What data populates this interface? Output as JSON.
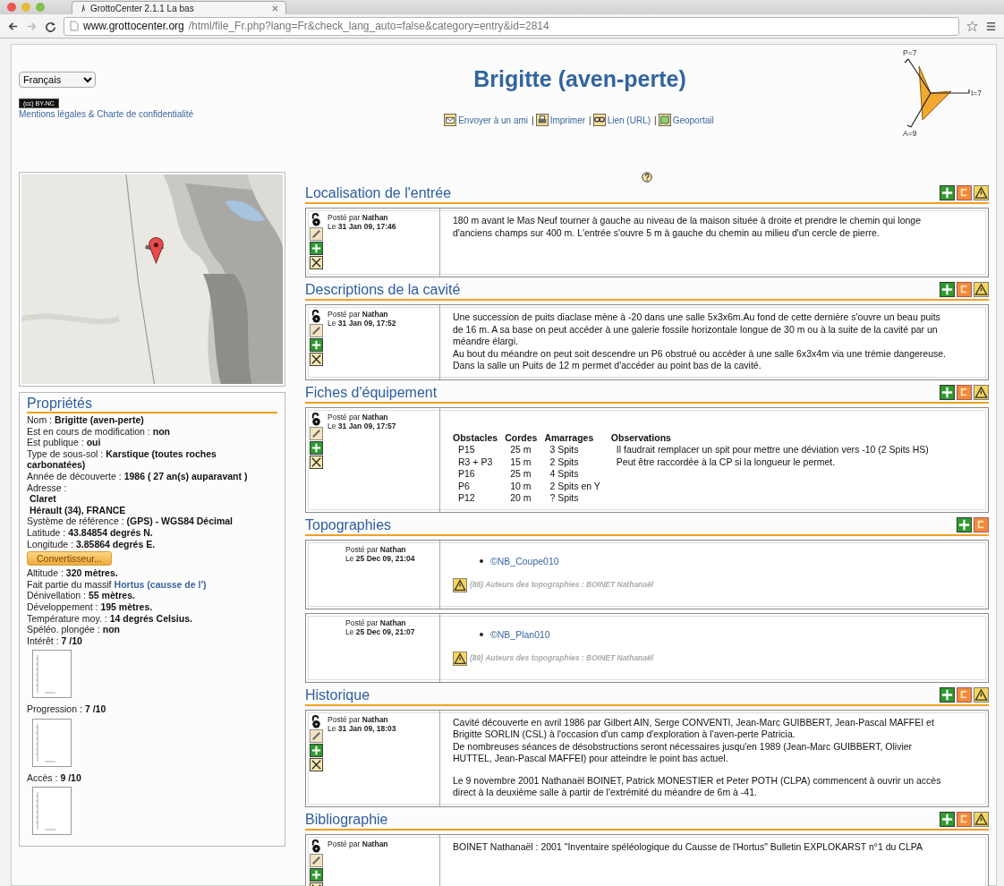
{
  "browser": {
    "tab_title": "GrottoCenter 2.1.1 La bas",
    "url_host": "www.grottocenter.org",
    "url_path": "/html/file_Fr.php?lang=Fr&check_lang_auto=false&category=entry&id=2814"
  },
  "language_select": "Français",
  "license": "(cc) BY-NC",
  "legal_link": "Mentions légales & Charte de confidentialité",
  "title": "Brigitte (aven-perte)",
  "link_separator": "|",
  "header_links": [
    {
      "kind": "mail",
      "label": "Envoyer à un ami"
    },
    {
      "kind": "print",
      "label": "Imprimer"
    },
    {
      "kind": "link",
      "label": "Lien (URL)"
    },
    {
      "kind": "map",
      "label": "Geoportail"
    }
  ],
  "radar": {
    "labels": [
      "P=7",
      "I=7",
      "A=9"
    ]
  },
  "properties": {
    "title": "Propriétés",
    "button": "Convertisseur...",
    "items": [
      {
        "kind": "field",
        "label": "Nom :",
        "value": "Brigitte (aven-perte)"
      },
      {
        "kind": "field",
        "label": "Est en cours de modification :",
        "value": "non"
      },
      {
        "kind": "field",
        "label": "Est publique :",
        "value": "oui"
      },
      {
        "kind": "field",
        "label": "Type de sous-sol :",
        "value": "Karstique (toutes roches carbonatées)"
      },
      {
        "kind": "field",
        "label": "Année de découverte :",
        "value": "1986 ( 27 an(s) auparavant )"
      },
      {
        "kind": "field",
        "label": "Adresse :"
      },
      {
        "kind": "line",
        "value": "Claret"
      },
      {
        "kind": "line",
        "value": "Hérault (34), FRANCE"
      },
      {
        "kind": "field",
        "label": "Système de référence :",
        "value": "(GPS) - WGS84 Décimal"
      },
      {
        "kind": "field",
        "label": "Latitude :",
        "value": "43.84854 degrés N."
      },
      {
        "kind": "field",
        "label": "Longitude :",
        "value": "3.85864 degrés E."
      },
      {
        "kind": "button"
      },
      {
        "kind": "field",
        "label": "Altitude :",
        "value": "320 mètres."
      },
      {
        "kind": "link",
        "label": "Fait partie du massif",
        "value": "Hortus (causse de l')"
      },
      {
        "kind": "field",
        "label": "Dénivellation :",
        "value": "55 mètres."
      },
      {
        "kind": "field",
        "label": "Développement :",
        "value": "195 mètres."
      },
      {
        "kind": "field",
        "label": "Température moy. :",
        "value": "14 degrés Celsius."
      },
      {
        "kind": "field",
        "label": "Spéléo. plongée :",
        "value": "non"
      },
      {
        "kind": "rating",
        "label": "Intérêt :",
        "value": "7 /10"
      },
      {
        "kind": "rating",
        "label": "Progression :",
        "value": "7 /10"
      },
      {
        "kind": "rating",
        "label": "Accès :",
        "value": "9 /10"
      }
    ]
  },
  "sections": [
    {
      "title": "Localisation de l'entrée",
      "tools": [
        {
          "kind": "add"
        },
        {
          "kind": "comment"
        },
        {
          "kind": "alert"
        }
      ],
      "posts": [
        {
          "author": "Posté par **Nathan**",
          "date": "Le **31 Jan 09, 17:46**",
          "editable": true,
          "kind": "text",
          "blocks": [
            [
              "180 m avant le Mas Neuf tourner à gauche au niveau de la maison située à droite et prendre le chemin qui longe d'anciens champs sur 400 m. L'entrée s'ouvre 5 m à gauche du chemin au milieu d'un cercle de pierre."
            ]
          ]
        }
      ]
    },
    {
      "title": "Descriptions de la cavité",
      "tools": [
        {
          "kind": "add"
        },
        {
          "kind": "comment"
        },
        {
          "kind": "alert"
        }
      ],
      "posts": [
        {
          "author": "Posté par **Nathan**",
          "date": "Le **31 Jan 09, 17:52**",
          "editable": true,
          "kind": "text",
          "blocks": [
            [
              "Une succession de puits diaclase mène à -20 dans une salle 5x3x6m.Au fond de cette dernière s'ouvre un beau puits de 16 m. A sa base on peut accéder à une galerie fossile horizontale longue de 30 m ou à la suite de la cavité par un méandre élargi.",
              "Au bout du méandre on peut soit descendre un P6 obstrué ou accéder à une salle 6x3x4m via une trémie dangereuse.",
              "Dans la salle un Puits de 12 m permet d'accéder au point bas de la cavité."
            ]
          ]
        }
      ]
    },
    {
      "title": "Fiches d'équipement",
      "tools": [
        {
          "kind": "add"
        },
        {
          "kind": "comment"
        },
        {
          "kind": "alert"
        }
      ],
      "posts": [
        {
          "author": "Posté par **Nathan**",
          "date": "Le **31 Jan 09, 17:57**",
          "editable": true,
          "kind": "table",
          "columns": [
            "Obstacles",
            "Cordes",
            "Amarrages",
            "Observations"
          ],
          "rows": [
            [
              "P15",
              "25 m",
              "3 Spits",
              "Il faudrait remplacer un spit pour mettre une déviation vers -10 (2 Spits HS)"
            ],
            [
              "R3 + P3",
              "15 m",
              "2 Spits",
              "Peut être raccordée à la CP si la longueur le permet."
            ],
            [
              "P16",
              "25 m",
              "4 Spits"
            ],
            [
              "P6",
              "10 m",
              "2 Spits en Y"
            ],
            [
              "P12",
              "20 m",
              "? Spits"
            ]
          ]
        }
      ]
    },
    {
      "title": "Topographies",
      "tools": [
        {
          "kind": "add"
        },
        {
          "kind": "comment"
        }
      ],
      "posts": [
        {
          "author": "Posté par **Nathan**",
          "date": "Le **25 Dec 09, 21:04**",
          "editable": false,
          "kind": "file",
          "file": "©NB_Coupe010",
          "note": "(88) Auteurs des topographies : BOINET Nathanaël"
        },
        {
          "author": "Posté par **Nathan**",
          "date": "Le **25 Dec 09, 21:07**",
          "editable": false,
          "kind": "file",
          "file": "©NB_Plan010",
          "note": "(89) Auteurs des topographies : BOINET Nathanaël"
        }
      ]
    },
    {
      "title": "Historique",
      "tools": [
        {
          "kind": "add"
        },
        {
          "kind": "comment"
        },
        {
          "kind": "alert"
        }
      ],
      "posts": [
        {
          "author": "Posté par **Nathan**",
          "date": "Le **31 Jan 09, 18:03**",
          "editable": true,
          "kind": "text",
          "blocks": [
            [
              "Cavité découverte en avril 1986 par Gilbert AIN, Serge CONVENTI, Jean-Marc GUIBBERT, Jean-Pascal MAFFEI et Brigitte SORLIN (CSL) à l'occasion d'un camp d'exploration à l'aven-perte Patricia.",
              "De nombreuses séances de désobstructions seront nécessaires jusqu'en 1989 (Jean-Marc GUIBBERT, Olivier HUTTEL, Jean-Pascal MAFFEI) pour atteindre le point bas actuel."
            ],
            [
              "Le 9 novembre 2001 Nathanaël BOINET, Patrick MONESTIER et Peter POTH (CLPA) commencent à ouvrir un accès direct à la deuxième salle à partir de l'extrémité du méandre de 6m à -41."
            ]
          ]
        }
      ]
    },
    {
      "title": "Bibliographie",
      "tools": [
        {
          "kind": "add"
        },
        {
          "kind": "comment"
        },
        {
          "kind": "alert"
        }
      ],
      "posts": [
        {
          "author": "Posté par **Nathan**",
          "editable": true,
          "kind": "text",
          "blocks": [
            [
              "BOINET Nathanaël : 2001 \"Inventaire spéléologique du Causse de l'Hortus\" Bulletin EXPLOKARST n°1 du CLPA"
            ]
          ]
        }
      ]
    }
  ]
}
